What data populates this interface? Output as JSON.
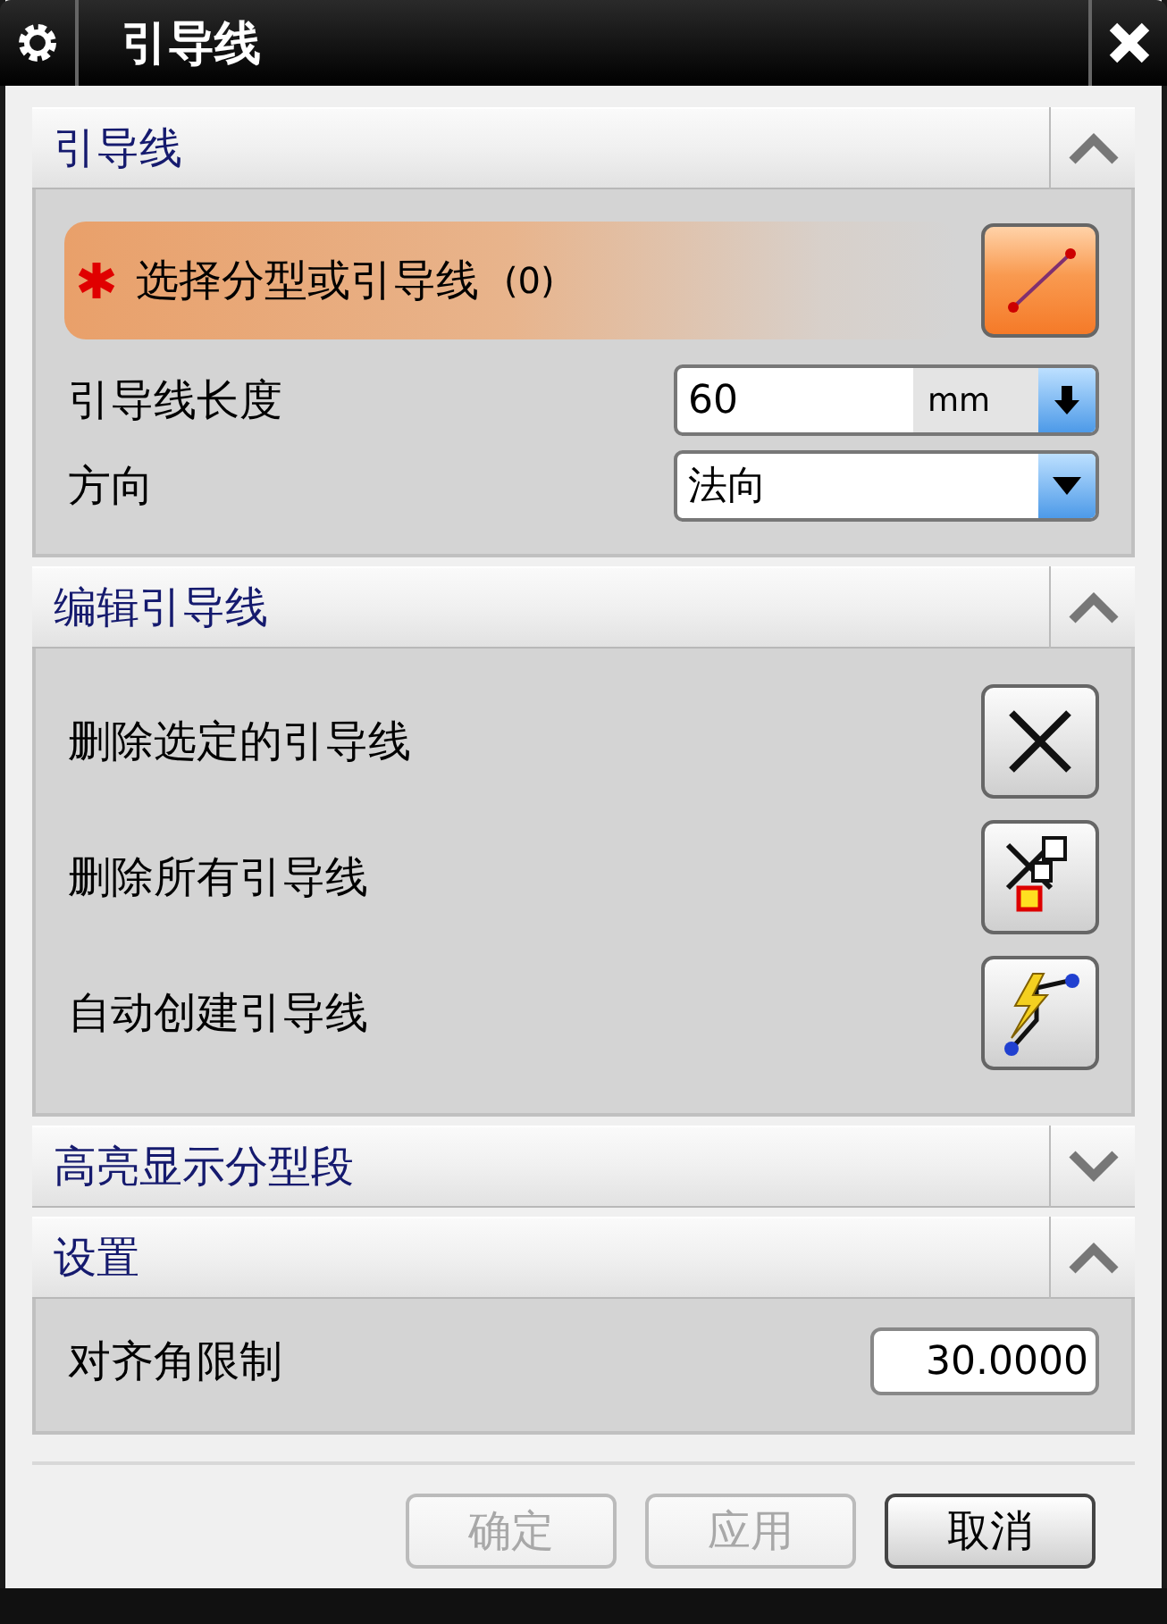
{
  "window": {
    "title": "引导线"
  },
  "sections": [
    {
      "title": "引导线",
      "expanded": true,
      "rows": [
        {
          "kind": "selection",
          "required": true,
          "label": "选择分型或引导线",
          "count": "(0)"
        },
        {
          "kind": "unitfield",
          "label": "引导线长度",
          "value": "60",
          "unit": "mm"
        },
        {
          "kind": "dropdown",
          "label": "方向",
          "value": "法向"
        }
      ]
    },
    {
      "title": "编辑引导线",
      "expanded": true,
      "rows": [
        {
          "kind": "deleteone",
          "label": "删除选定的引导线"
        },
        {
          "kind": "deleteall",
          "label": "删除所有引导线"
        },
        {
          "kind": "autocreate",
          "label": "自动创建引导线"
        }
      ]
    },
    {
      "title": "高亮显示分型段",
      "expanded": false
    },
    {
      "title": "设置",
      "expanded": true,
      "rows": [
        {
          "kind": "numberfield",
          "label": "对齐角限制",
          "value": "30.0000"
        }
      ]
    }
  ],
  "buttons": [
    {
      "label": "确定",
      "disabled": true
    },
    {
      "label": "应用",
      "disabled": true
    },
    {
      "label": "取消",
      "disabled": false
    }
  ]
}
